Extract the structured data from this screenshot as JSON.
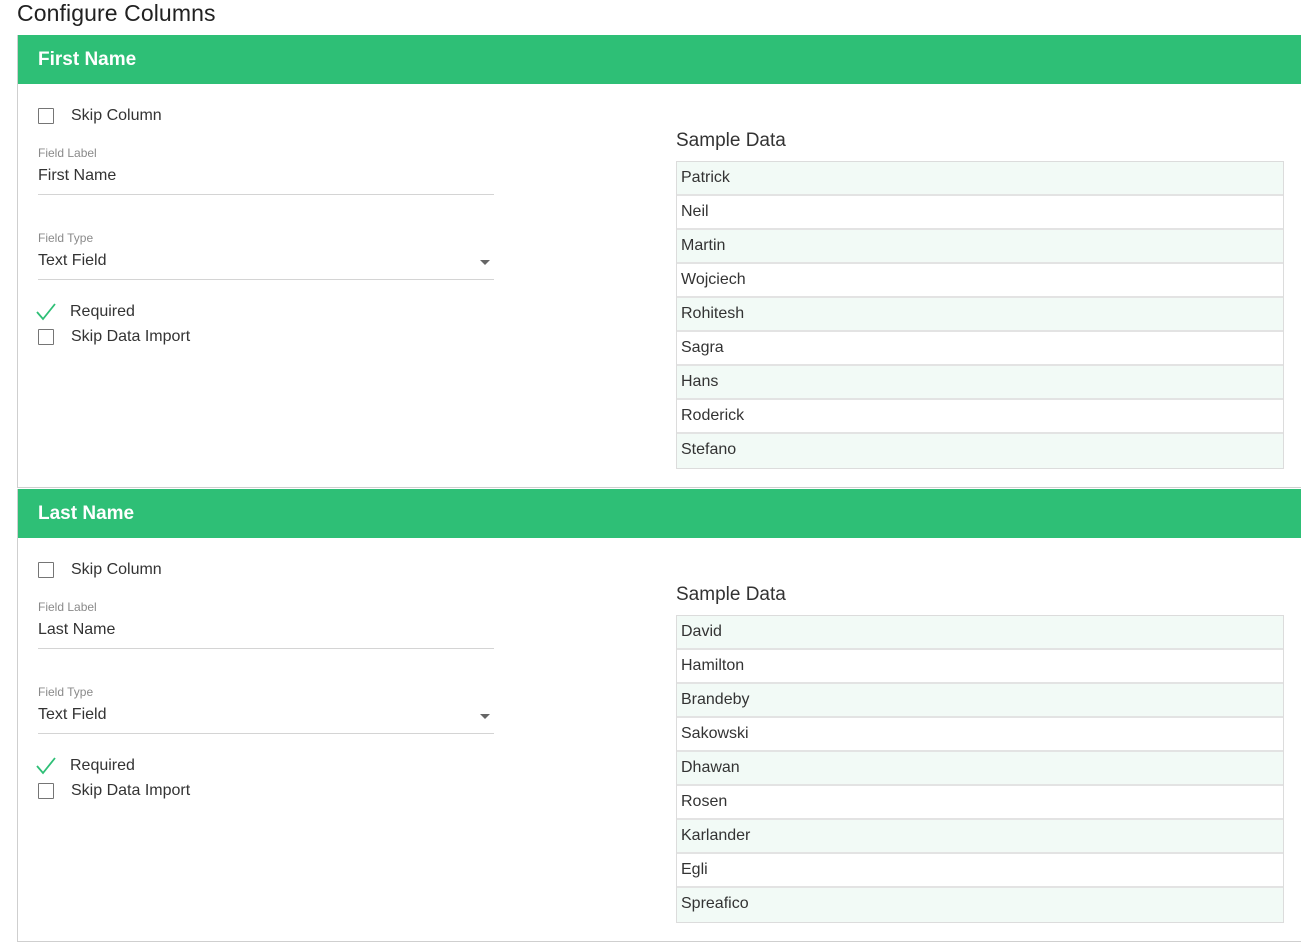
{
  "page": {
    "title": "Configure Columns"
  },
  "colors": {
    "header_green": "#2ebf76",
    "check_green": "#2ebf76",
    "row_tint": "#f2faf6"
  },
  "columns": [
    {
      "header": "First Name",
      "skip_column_label": "Skip Column",
      "skip_column_checked": false,
      "field_label_caption": "Field Label",
      "field_label_value": "First Name",
      "field_type_caption": "Field Type",
      "field_type_value": "Text Field",
      "required_label": "Required",
      "required_checked": true,
      "skip_import_label": "Skip Data Import",
      "skip_import_checked": false,
      "sample_title": "Sample Data",
      "sample_values": [
        "Patrick",
        "Neil",
        "Martin",
        "Wojciech",
        "Rohitesh",
        "Sagra",
        "Hans",
        "Roderick",
        "Stefano"
      ]
    },
    {
      "header": "Last Name",
      "skip_column_label": "Skip Column",
      "skip_column_checked": false,
      "field_label_caption": "Field Label",
      "field_label_value": "Last Name",
      "field_type_caption": "Field Type",
      "field_type_value": "Text Field",
      "required_label": "Required",
      "required_checked": true,
      "skip_import_label": "Skip Data Import",
      "skip_import_checked": false,
      "sample_title": "Sample Data",
      "sample_values": [
        "David",
        "Hamilton",
        "Brandeby",
        "Sakowski",
        "Dhawan",
        "Rosen",
        "Karlander",
        "Egli",
        "Spreafico"
      ]
    }
  ]
}
